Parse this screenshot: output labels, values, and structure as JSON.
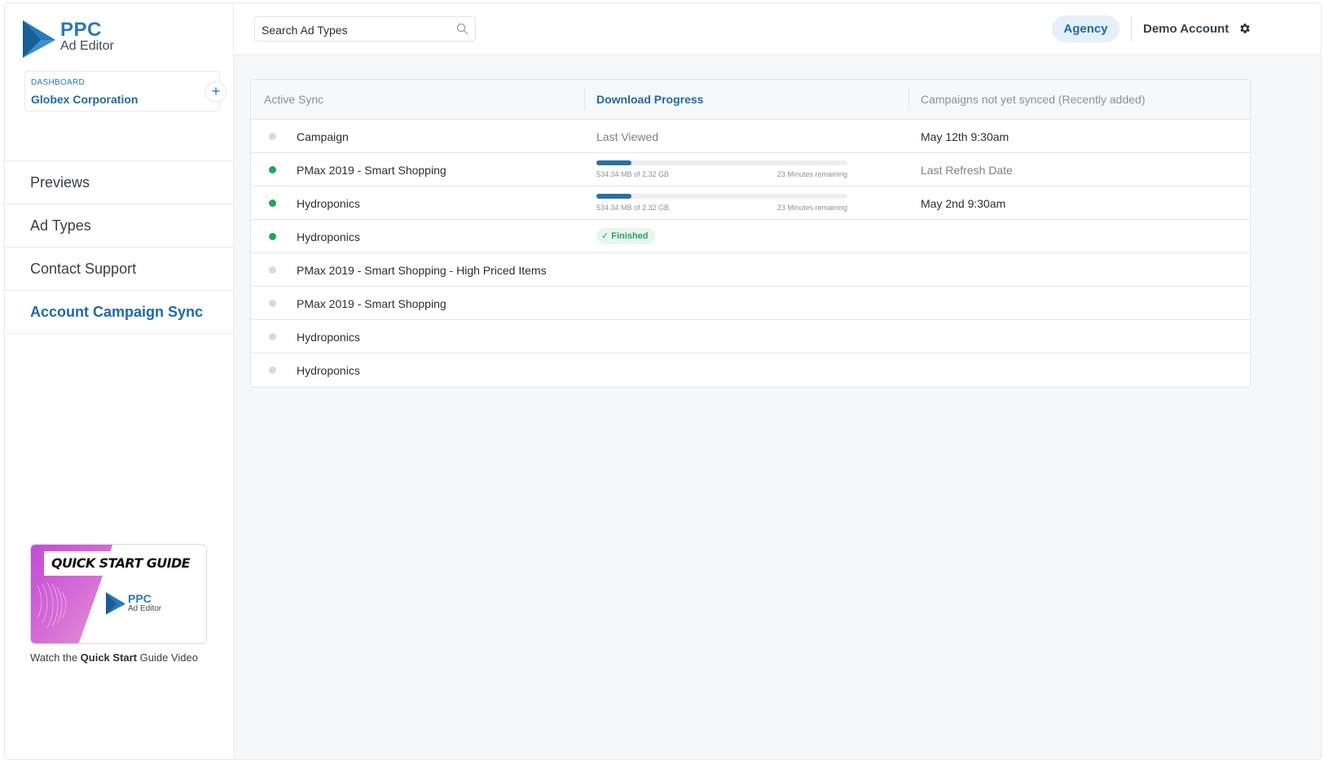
{
  "brand": {
    "name": "PPC",
    "subtitle": "Ad Editor",
    "color": "#2a79b8"
  },
  "dashboard": {
    "label": "DASHBOARD",
    "organization": "Globex Corporation",
    "add_icon": "plus-icon"
  },
  "sidebar": {
    "items": [
      {
        "label": "Previews",
        "active": false
      },
      {
        "label": "Ad Types",
        "active": false
      },
      {
        "label": "Contact Support",
        "active": false
      },
      {
        "label": "Account Campaign Sync",
        "active": true
      }
    ],
    "quick_start": {
      "thumb_title": "QUICK START GUIDE",
      "thumb_brand": "PPC",
      "thumb_brand_sub": "Ad Editor",
      "caption_prefix": "Watch the ",
      "caption_bold": "Quick Start",
      "caption_suffix": " Guide Video"
    }
  },
  "topbar": {
    "search_placeholder": "Search Ad Types",
    "agency_label": "Agency",
    "account_label": "Demo Account",
    "settings_icon": "gear-icon"
  },
  "table": {
    "headers": {
      "active_sync": "Active Sync",
      "download_progress": "Download Progress",
      "not_synced": "Campaigns not yet synced (Recently added)"
    },
    "rows": [
      {
        "status": "idle",
        "name": "Campaign",
        "progress_text": "Last Viewed",
        "date": "May 12th 9:30am"
      },
      {
        "status": "active",
        "name": "PMax 2019 - Smart Shopping",
        "progress": {
          "fraction": 0.14,
          "amount": "534.34 MB of 2.32 GB",
          "remaining": "23 Minutes remaining"
        },
        "date": "Last Refresh Date",
        "date_muted": true
      },
      {
        "status": "active",
        "name": "Hydroponics",
        "progress": {
          "fraction": 0.14,
          "amount": "534.34 MB of 2.32 GB",
          "remaining": "23 Minutes remaining"
        },
        "date": "May 2nd 9:30am"
      },
      {
        "status": "active",
        "name": "Hydroponics",
        "badge": "Finished"
      },
      {
        "status": "idle",
        "name": "PMax 2019 - Smart Shopping - High Priced Items"
      },
      {
        "status": "idle",
        "name": "PMax 2019 - Smart Shopping"
      },
      {
        "status": "idle",
        "name": "Hydroponics"
      },
      {
        "status": "idle",
        "name": "Hydroponics"
      }
    ]
  },
  "colors": {
    "accent": "#1f6aa5",
    "success": "#26a35b",
    "progress": "#2a6fa5",
    "idle_dot": "#d7d9dc"
  }
}
